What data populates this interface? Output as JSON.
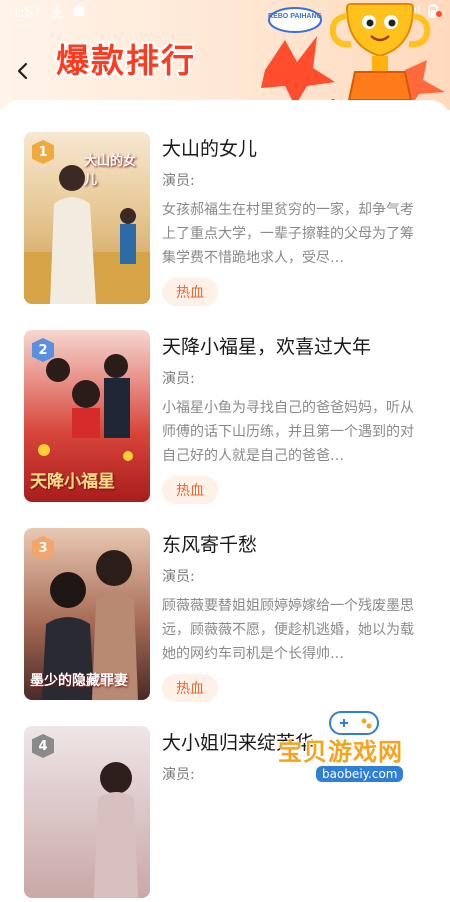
{
  "status_bar": {
    "time": "1:57"
  },
  "header": {
    "title": "爆款排行",
    "badge_text": "REBO PAIHANG",
    "accent": "#ff3b1f"
  },
  "items": [
    {
      "rank": "1",
      "title": "大山的女儿",
      "actor_label": "演员:",
      "description": "女孩郝福生在村里贫穷的一家，却争气考上了重点大学，一辈子擦鞋的父母为了筹集学费不惜跪地求人，受尽…",
      "tag": "热血",
      "poster_caption": "大山的女儿",
      "badge_color": "#f0a93a"
    },
    {
      "rank": "2",
      "title": "天降小福星，欢喜过大年",
      "actor_label": "演员:",
      "description": "小福星小鱼为寻找自己的爸爸妈妈，听从师傅的话下山历练，并且第一个遇到的对自己好的人就是自己的爸爸…",
      "tag": "热血",
      "poster_caption": "天降小福星",
      "badge_color": "#5b8fe0"
    },
    {
      "rank": "3",
      "title": "东风寄千愁",
      "actor_label": "演员:",
      "description": "顾薇薇要替姐姐顾婷婷嫁给一个残废墨思远，顾薇薇不愿，便趁机逃婚，她以为载她的网约车司机是个长得帅…",
      "tag": "热血",
      "poster_caption": "墨少的隐藏罪妻",
      "badge_color": "#f3a56b"
    },
    {
      "rank": "4",
      "title": "大小姐归来绽芳华",
      "actor_label": "演员:",
      "description": "",
      "tag": "",
      "poster_caption": "",
      "badge_color": "#8a8a8a"
    }
  ],
  "watermark": {
    "text": "宝贝游戏网",
    "url": "baobeiy.com"
  }
}
